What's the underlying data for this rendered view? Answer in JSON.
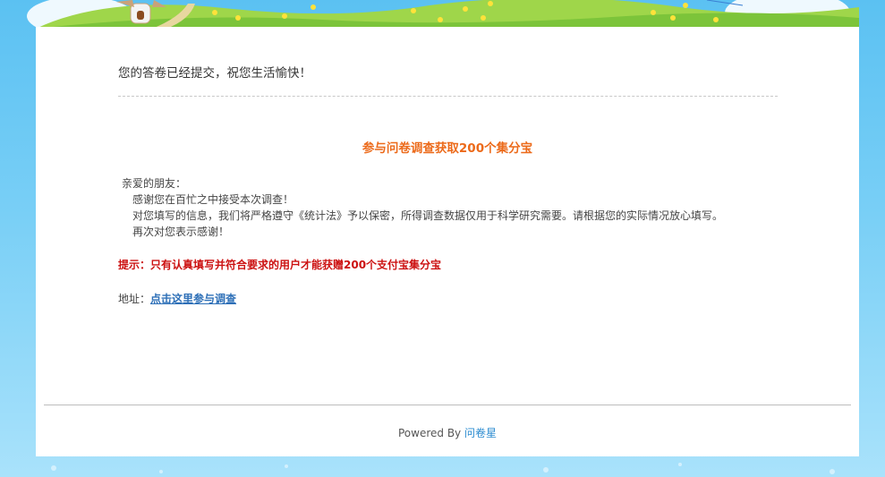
{
  "header": {
    "illustration": "cartoon-meadow-with-windmill-and-flowers"
  },
  "main": {
    "thanks_message": "您的答卷已经提交，祝您生活愉快！",
    "promo_title": "参与问卷调查获取200个集分宝",
    "greeting": "亲爱的朋友：",
    "lines": [
      "感谢您在百忙之中接受本次调查！",
      "对您填写的信息，我们将严格遵守《统计法》予以保密，所得调查数据仅用于科学研究需要。请根据您的实际情况放心填写。",
      "再次对您表示感谢！"
    ],
    "hint": "提示：只有认真填写并符合要求的用户才能获赠200个支付宝集分宝",
    "address_label": "地址：",
    "address_link": "点击这里参与调查"
  },
  "footer": {
    "powered_by": "Powered By",
    "brand_link": "问卷星"
  },
  "colors": {
    "background": "#79cff6",
    "card": "#ffffff",
    "promo_title": "#ec6a1a",
    "hint": "#cc1111",
    "link": "#2d6fb7",
    "footer_link": "#2a8bd0"
  }
}
